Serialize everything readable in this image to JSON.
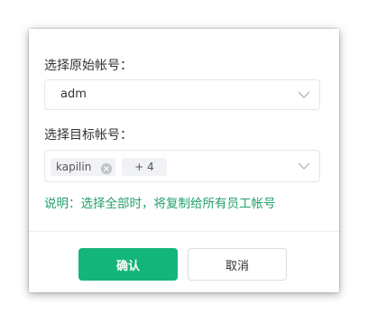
{
  "dialog": {
    "source_label": "选择原始帐号：",
    "source_value": "adm",
    "target_label": "选择目标帐号：",
    "target_tags": [
      {
        "label": "kapilin"
      },
      {
        "label": "+ 4"
      }
    ],
    "note": "说明：选择全部时，将复制给所有员工帐号",
    "confirm_label": "确认",
    "cancel_label": "取消"
  },
  "colors": {
    "primary": "#13b57a",
    "note": "#22a06b",
    "border": "#e6e6e6"
  },
  "icons": {
    "dropdown": "chevron-down-icon",
    "tag_remove": "close-circle-icon"
  }
}
